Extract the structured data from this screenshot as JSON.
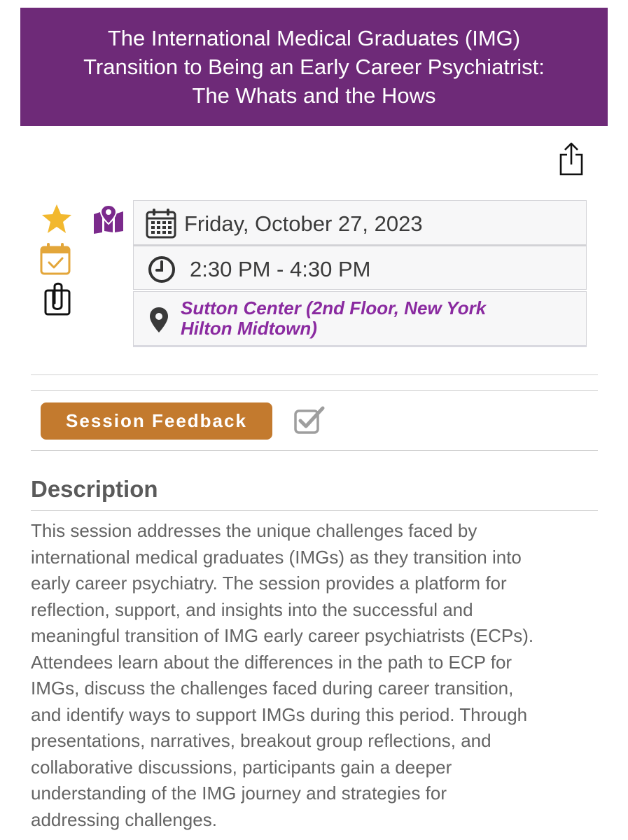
{
  "header": {
    "title_lines": [
      "The International Medical Graduates (IMG)",
      "Transition to Being an Early Career Psychiatrist:",
      "The Whats and the Hows"
    ]
  },
  "actions": {
    "share_icon": "share-icon",
    "favorite_icon": "star-icon",
    "map_icon": "map-pin-icon",
    "add_to_calendar_icon": "calendar-check-icon",
    "attachments_icon": "paperclip-icon"
  },
  "session": {
    "date": "Friday, October 27, 2023",
    "time": "2:30 PM - 4:30 PM",
    "location_lines": [
      "Sutton Center (2nd Floor, New York",
      "Hilton Midtown)"
    ]
  },
  "feedback": {
    "button_label": "Session Feedback"
  },
  "description": {
    "heading": "Description",
    "lines": [
      "This session addresses the unique challenges faced by",
      "international medical graduates (IMGs) as they transition into",
      "early career psychiatry. The session provides a platform for",
      "reflection, support, and insights into the successful and",
      "meaningful transition of IMG early career psychiatrists (ECPs).",
      "Attendees learn about the differences in the path to ECP for",
      "IMGs, discuss the challenges faced during career transition,",
      "and identify ways to support IMGs during this period. Through",
      "presentations, narratives, breakout group reflections, and",
      "collaborative discussions, participants gain a deeper",
      "understanding of the IMG journey and strategies for",
      "addressing challenges."
    ]
  },
  "colors": {
    "banner": "#6e2a78",
    "accent_purple": "#8a2aa0",
    "star": "#f2b82e",
    "calendar_check": "#e3a63a",
    "feedback_button": "#c37a2e"
  }
}
